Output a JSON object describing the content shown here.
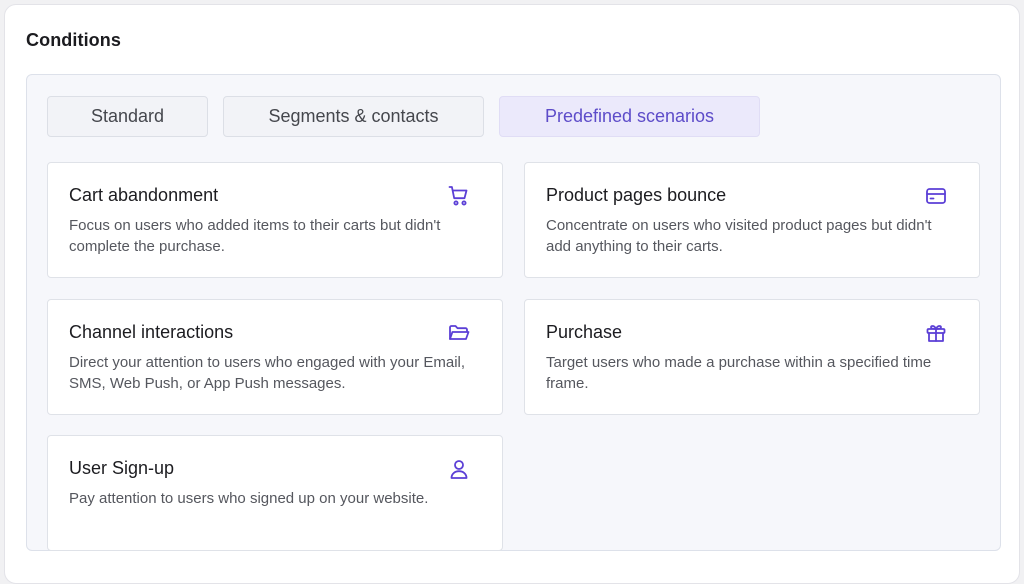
{
  "panel": {
    "title": "Conditions"
  },
  "tabs": [
    {
      "label": "Standard",
      "active": false
    },
    {
      "label": "Segments & contacts",
      "active": false
    },
    {
      "label": "Predefined scenarios",
      "active": true
    }
  ],
  "scenarios": [
    {
      "title": "Cart abandonment",
      "description": "Focus on users who added items to their carts but didn't complete the purchase.",
      "icon": "shopping-cart-icon"
    },
    {
      "title": "Product pages bounce",
      "description": "Concentrate on users who visited product pages but didn't add anything to their carts.",
      "icon": "browser-window-icon"
    },
    {
      "title": "Channel interactions",
      "description": "Direct your attention to users who engaged with your Email, SMS, Web Push, or App Push messages.",
      "icon": "folder-icon"
    },
    {
      "title": "Purchase",
      "description": "Target users who made a purchase within a specified time frame.",
      "icon": "gift-icon"
    },
    {
      "title": "User Sign-up",
      "description": "Pay attention to users who signed up on your website.",
      "icon": "user-icon"
    }
  ],
  "colors": {
    "accent": "#5b3fd6",
    "tab_active_bg": "#ebe9fb",
    "inner_bg": "#f6f7fb"
  }
}
